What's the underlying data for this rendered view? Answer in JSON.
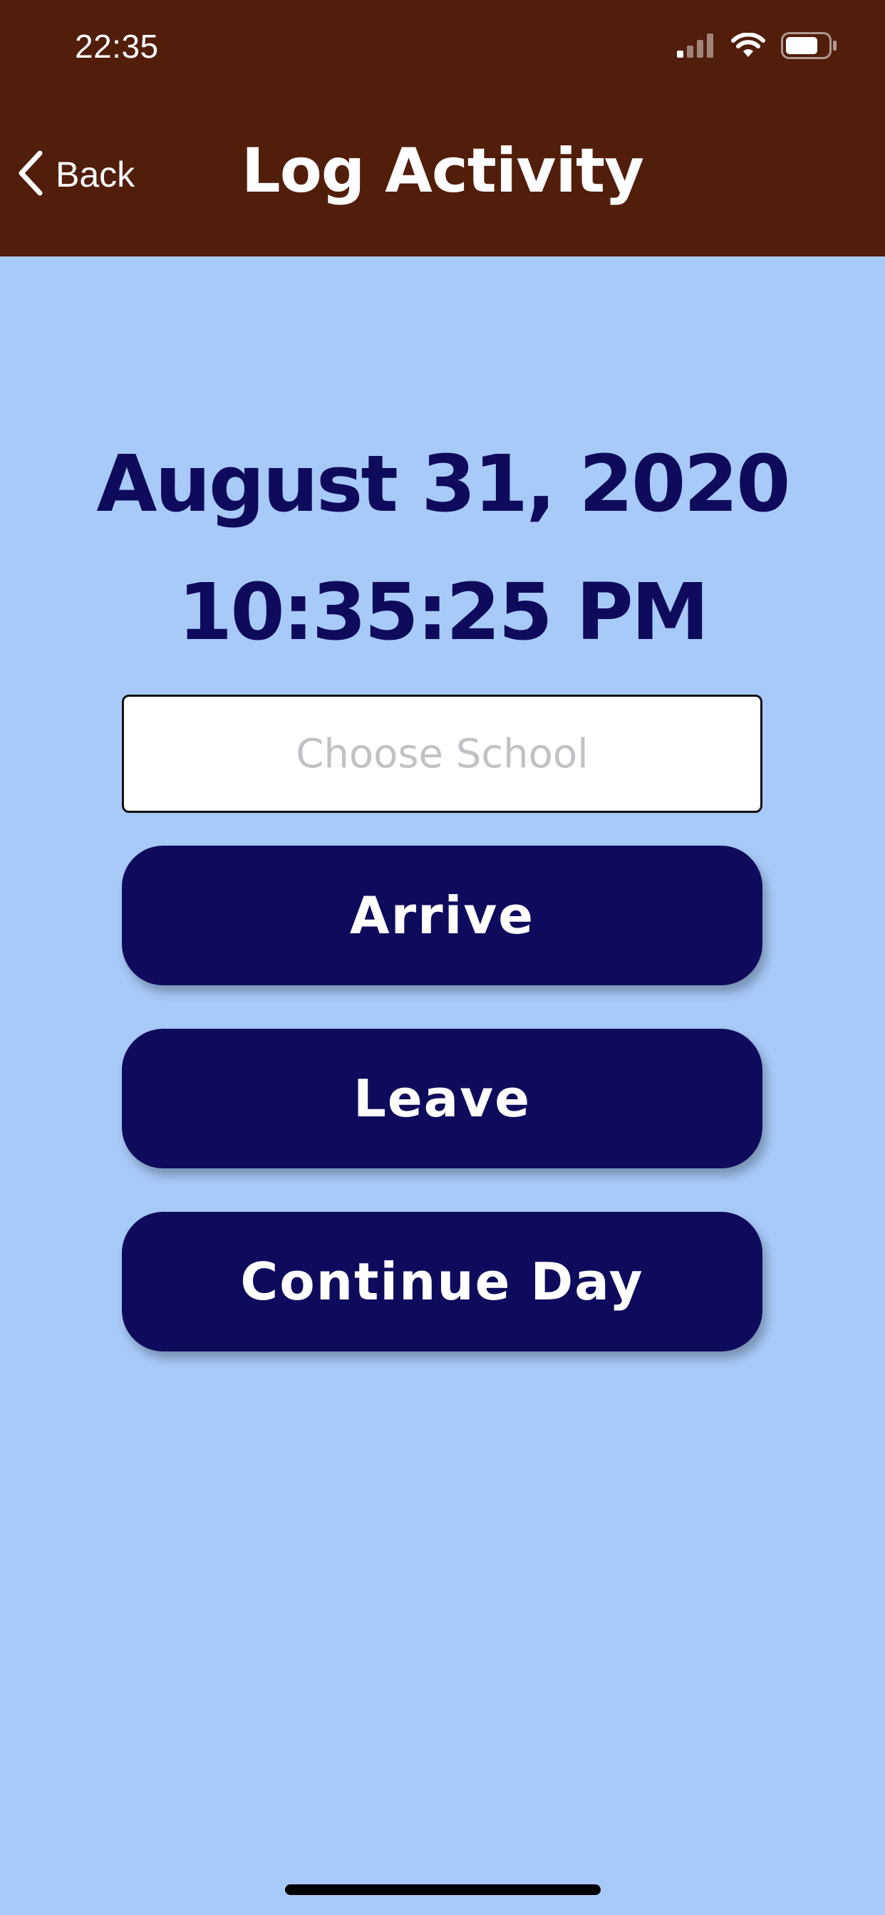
{
  "status_bar": {
    "time": "22:35",
    "icons": [
      "cellular-signal-icon",
      "wifi-icon",
      "battery-icon"
    ]
  },
  "nav": {
    "back_label": "Back",
    "back_icon": "chevron-left-icon",
    "title": "Log Activity"
  },
  "main": {
    "date": "August 31, 2020",
    "time": "10:35:25 PM",
    "school_input": {
      "placeholder": "Choose School",
      "value": ""
    },
    "buttons": {
      "arrive": "Arrive",
      "leave": "Leave",
      "continue_day": "Continue Day"
    }
  },
  "colors": {
    "header_bg": "#521e0c",
    "page_bg": "#a8caf9",
    "primary": "#0f0b5c",
    "button_text": "#ffffff"
  }
}
